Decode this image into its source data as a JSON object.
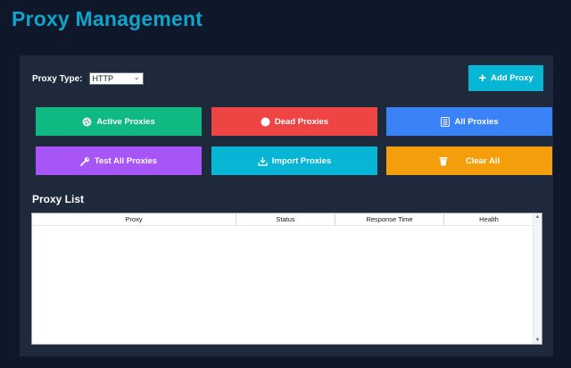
{
  "page": {
    "title": "Proxy Management"
  },
  "proxy_type": {
    "label": "Proxy Type:",
    "selected": "HTTP"
  },
  "toolbar": {
    "add_label": "Add Proxy"
  },
  "actions": {
    "active": {
      "label": "Active Proxies",
      "color": "#10b981"
    },
    "dead": {
      "label": "Dead Proxies",
      "color": "#ef4444"
    },
    "all": {
      "label": "All Proxies",
      "color": "#3b82f6"
    },
    "test": {
      "label": "Test All Proxies",
      "color": "#a855f7"
    },
    "import": {
      "label": "Import Proxies",
      "color": "#06b6d4"
    },
    "clear": {
      "label": "Clear All",
      "color": "#f59e0b"
    }
  },
  "proxy_list": {
    "title": "Proxy List",
    "columns": [
      "Proxy",
      "Status",
      "Response Time",
      "Health"
    ],
    "rows": []
  },
  "colors": {
    "background": "#0f172a",
    "panel": "#1e293b",
    "accent": "#0ea5c9"
  },
  "icons": {
    "add": "plus-icon",
    "active": "circle-dots-icon",
    "dead": "circle-icon",
    "all": "list-icon",
    "test": "wrench-icon",
    "import": "import-icon",
    "clear": "trash-icon"
  }
}
